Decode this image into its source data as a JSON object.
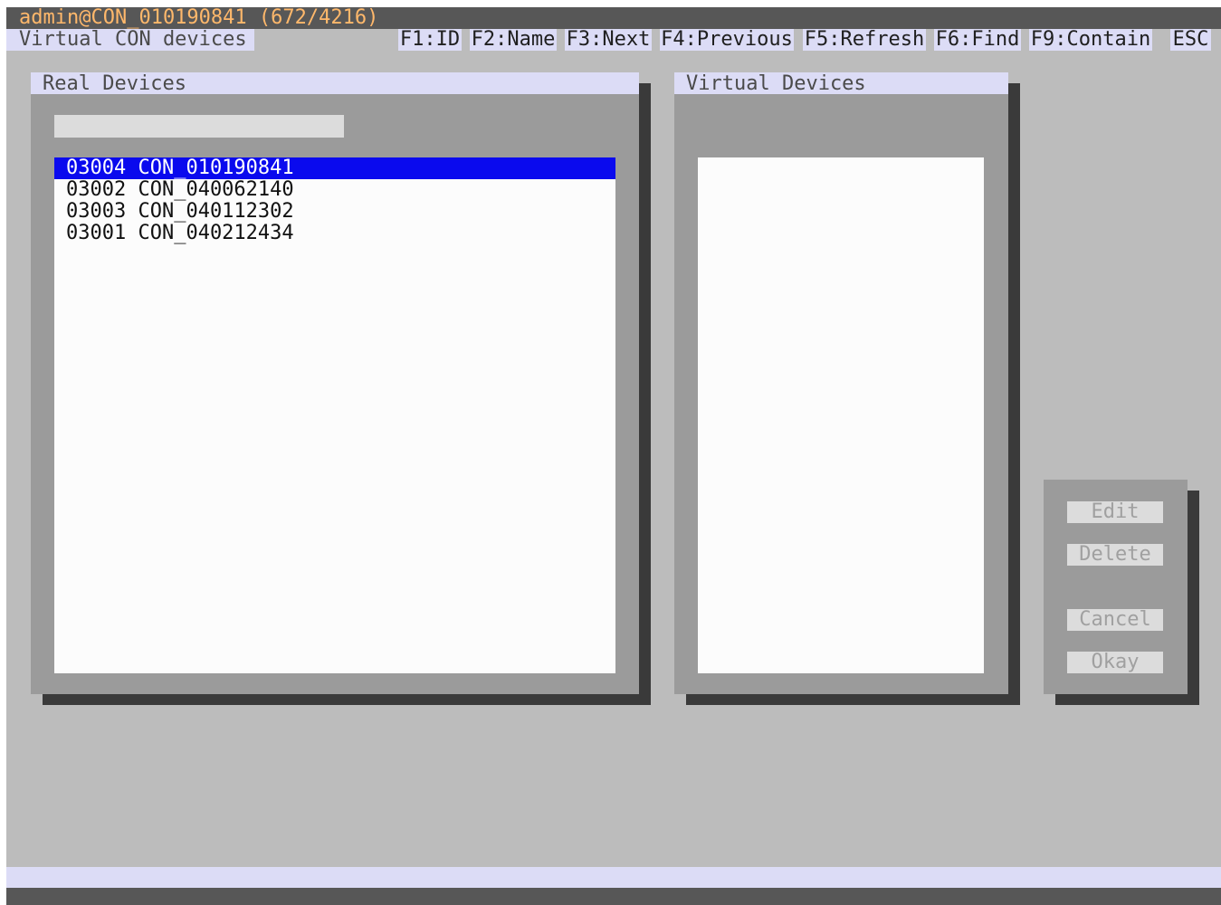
{
  "header": {
    "title": "admin@CON_010190841 (672/4216)",
    "subtitle": "Virtual CON devices"
  },
  "function_keys": [
    {
      "label": "F1:ID"
    },
    {
      "label": "F2:Name"
    },
    {
      "label": "F3:Next"
    },
    {
      "label": "F4:Previous"
    },
    {
      "label": "F5:Refresh"
    },
    {
      "label": "F6:Find"
    },
    {
      "label": "F9:Contain"
    },
    {
      "label": "ESC"
    }
  ],
  "real_devices": {
    "title": "Real Devices",
    "filter_value": "",
    "items": [
      {
        "id": "03004",
        "name": "CON_010190841",
        "text": "03004 CON_010190841",
        "selected": true
      },
      {
        "id": "03002",
        "name": "CON_040062140",
        "text": "03002 CON_040062140",
        "selected": false
      },
      {
        "id": "03003",
        "name": "CON_040112302",
        "text": "03003 CON_040112302",
        "selected": false
      },
      {
        "id": "03001",
        "name": "CON_040212434",
        "text": "03001 CON_040212434",
        "selected": false
      }
    ]
  },
  "virtual_devices": {
    "title": "Virtual Devices",
    "items": []
  },
  "actions": {
    "edit": "Edit",
    "delete": "Delete",
    "cancel": "Cancel",
    "okay": "Okay"
  },
  "colors": {
    "background": "#bcbcbc",
    "title_bar": "#575757",
    "title_text": "#ffb86b",
    "label_bg": "#dcdcf6",
    "selection": "#0a0aee",
    "disabled_text": "#a0a0a0"
  }
}
